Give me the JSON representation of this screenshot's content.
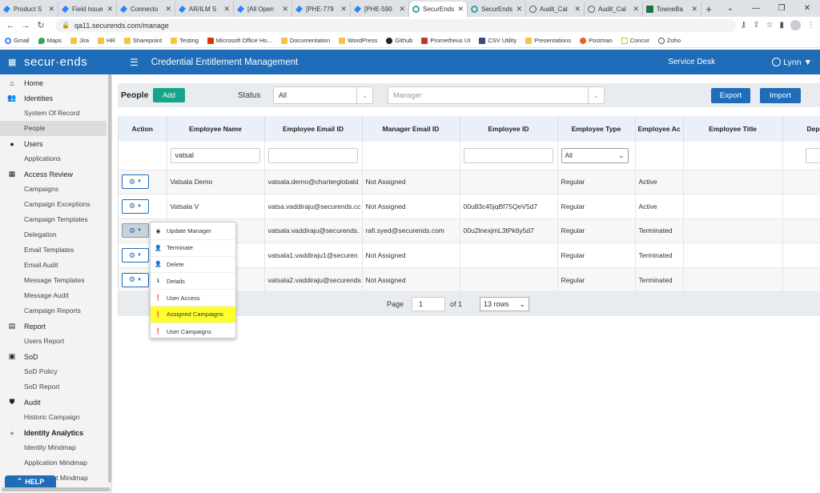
{
  "browser": {
    "tabs": [
      {
        "label": "Product S",
        "icon": "confluence-icon",
        "active": false
      },
      {
        "label": "Field Issue",
        "icon": "confluence-icon",
        "active": false
      },
      {
        "label": "Connecto",
        "icon": "confluence-icon",
        "active": false
      },
      {
        "label": "AR/ILM S",
        "icon": "confluence-icon",
        "active": false
      },
      {
        "label": "[All Open",
        "icon": "confluence-icon",
        "active": false
      },
      {
        "label": "[PHE-779",
        "icon": "confluence-icon",
        "active": false
      },
      {
        "label": "[PHE-590",
        "icon": "confluence-icon",
        "active": false
      },
      {
        "label": "SecurEnds",
        "icon": "securends-icon",
        "active": true
      },
      {
        "label": "SecurEnds",
        "icon": "securends-icon",
        "active": false
      },
      {
        "label": "Audit_Cal",
        "icon": "globe-icon",
        "active": false
      },
      {
        "label": "Audit_Cal",
        "icon": "globe-icon",
        "active": false
      },
      {
        "label": "TowneBa",
        "icon": "excel-icon",
        "active": false
      }
    ],
    "url": "qa11.securends.com/manage",
    "bookmarks": [
      {
        "label": "Gmail",
        "icon": "google-icon"
      },
      {
        "label": "Maps",
        "icon": "maps-icon"
      },
      {
        "label": "Jira",
        "icon": "folder-icon"
      },
      {
        "label": "HR",
        "icon": "folder-icon"
      },
      {
        "label": "Sharepoint",
        "icon": "folder-icon"
      },
      {
        "label": "Testing",
        "icon": "folder-icon"
      },
      {
        "label": "Microsoft Office Ho...",
        "icon": "office-icon"
      },
      {
        "label": "Documentation",
        "icon": "folder-icon"
      },
      {
        "label": "WordPress",
        "icon": "folder-icon"
      },
      {
        "label": "Github",
        "icon": "github-icon"
      },
      {
        "label": "Prometheus UI",
        "icon": "prometheus-icon"
      },
      {
        "label": "CSV Utility",
        "icon": "csv-icon"
      },
      {
        "label": "Presentations",
        "icon": "folder-icon"
      },
      {
        "label": "Postman",
        "icon": "postman-icon"
      },
      {
        "label": "Concur",
        "icon": "concur-icon"
      },
      {
        "label": "Zoho",
        "icon": "globe-icon"
      }
    ]
  },
  "header": {
    "logo": "secur·ends",
    "title": "Credential Entitlement Management",
    "service_desk": "Service Desk",
    "user": "Lynn"
  },
  "sidebar": {
    "sections": [
      {
        "label": "Home",
        "icon": "home-icon",
        "items": []
      },
      {
        "label": "Identities",
        "icon": "users-icon",
        "items": [
          "System Of Record",
          "People"
        ]
      },
      {
        "label": "Users",
        "icon": "user-icon",
        "items": [
          "Applications"
        ]
      },
      {
        "label": "Access Review",
        "icon": "grid-icon",
        "items": [
          "Campaigns",
          "Campaign Exceptions",
          "Campaign Templates",
          "Delegation",
          "Email Templates",
          "Email Audit",
          "Message Templates",
          "Message Audit",
          "Campaign Reports"
        ]
      },
      {
        "label": "Report",
        "icon": "report-icon",
        "items": [
          "Users Report"
        ]
      },
      {
        "label": "SoD",
        "icon": "sod-icon",
        "items": [
          "SoD Policy",
          "SoD Report"
        ]
      },
      {
        "label": "Audit",
        "icon": "shield-icon",
        "items": [
          "Historic Campaign"
        ]
      },
      {
        "label": "Identity Analytics",
        "icon": "analytics-icon",
        "items": [
          "Identity Mindmap",
          "Application Mindmap",
          "Entitlement Mindmap"
        ]
      }
    ],
    "active_item": "People",
    "help": "HELP"
  },
  "toolbar": {
    "title": "People",
    "add": "Add",
    "status_label": "Status",
    "status_value": "All",
    "manager_placeholder": "Manager",
    "export": "Export",
    "import": "Import"
  },
  "table": {
    "columns": [
      "Action",
      "Employee Name",
      "Employee Email ID",
      "Manager Email ID",
      "Employee ID",
      "Employee Type",
      "Employee Ac",
      "Employee Title",
      "Depa"
    ],
    "filters": {
      "employee_name": "vatsal",
      "employee_type": "All"
    },
    "rows": [
      {
        "name": "Vatsala Demo",
        "email": "vatsala.demo@charterglobald",
        "manager": "Not Assigned",
        "emp_id": "",
        "type": "Regular",
        "status": "Active"
      },
      {
        "name": "Vatsala V",
        "email": "vatsa.vaddiraju@securends.cc",
        "manager": "Not Assigned",
        "emp_id": "00u83c45jqBf75QeV5d7",
        "type": "Regular",
        "status": "Active"
      },
      {
        "name": "",
        "email": "vatsala.vaddiraju@securends.",
        "manager": "rafi.syed@securends.com",
        "emp_id": "00u2lnexjmL3tPk6y5d7",
        "type": "Regular",
        "status": "Terminated"
      },
      {
        "name": "",
        "email": "vatsala1.vaddiraju1@securen",
        "manager": "Not Assigned",
        "emp_id": "",
        "type": "Regular",
        "status": "Terminated"
      },
      {
        "name": "",
        "email": "vatsala2.vaddiraju@securends",
        "manager": "Not Assigned",
        "emp_id": "",
        "type": "Regular",
        "status": "Terminated"
      }
    ],
    "pager": {
      "page_label": "Page",
      "page": "1",
      "of_label": "of 1",
      "rows_option": "13 rows"
    }
  },
  "action_menu": {
    "items": [
      {
        "label": "Update Manager",
        "icon": "user-circle-icon",
        "highlighted": false
      },
      {
        "label": "Terminate",
        "icon": "user-remove-icon",
        "highlighted": false
      },
      {
        "label": "Delete",
        "icon": "user-delete-icon",
        "highlighted": false
      },
      {
        "label": "Details",
        "icon": "info-icon",
        "highlighted": false
      },
      {
        "label": "User Access",
        "icon": "alert-icon",
        "highlighted": false
      },
      {
        "label": "Assigned Campaigns",
        "icon": "alert-icon",
        "highlighted": true
      },
      {
        "label": "User Campaigns",
        "icon": "alert-icon",
        "highlighted": false
      }
    ]
  }
}
